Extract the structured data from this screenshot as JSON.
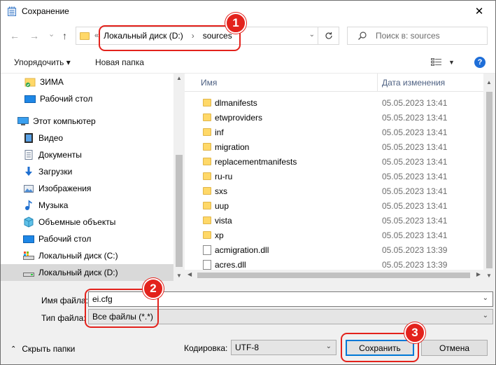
{
  "window": {
    "title": "Сохранение",
    "close_glyph": "✕"
  },
  "nav": {
    "back": "←",
    "forward": "→",
    "down": "⌄",
    "up": "↑"
  },
  "address": {
    "overflow": "«",
    "crumbs": [
      "Локальный диск (D:)",
      "sources"
    ],
    "separator": "›"
  },
  "search": {
    "placeholder": "Поиск в: sources"
  },
  "toolbar": {
    "organize": "Упорядочить ▾",
    "new_folder": "Новая папка",
    "help": "?"
  },
  "navpane": {
    "items": [
      {
        "label": "ЗИМА",
        "icon": "folder-shared-icon"
      },
      {
        "label": "Рабочий стол",
        "icon": "desktop-icon"
      },
      {
        "label": "Этот компьютер",
        "icon": "computer-icon"
      },
      {
        "label": "Видео",
        "icon": "video-icon"
      },
      {
        "label": "Документы",
        "icon": "documents-icon"
      },
      {
        "label": "Загрузки",
        "icon": "downloads-icon"
      },
      {
        "label": "Изображения",
        "icon": "pictures-icon"
      },
      {
        "label": "Музыка",
        "icon": "music-icon"
      },
      {
        "label": "Объемные объекты",
        "icon": "3d-objects-icon"
      },
      {
        "label": "Рабочий стол",
        "icon": "desktop-icon"
      },
      {
        "label": "Локальный диск (C:)",
        "icon": "drive-icon"
      },
      {
        "label": "Локальный диск (D:)",
        "icon": "drive-icon"
      }
    ]
  },
  "filelist": {
    "columns": {
      "name": "Имя",
      "date": "Дата изменения"
    },
    "rows": [
      {
        "name": "dlmanifests",
        "date": "05.05.2023 13:41",
        "type": "folder"
      },
      {
        "name": "etwproviders",
        "date": "05.05.2023 13:41",
        "type": "folder"
      },
      {
        "name": "inf",
        "date": "05.05.2023 13:41",
        "type": "folder"
      },
      {
        "name": "migration",
        "date": "05.05.2023 13:41",
        "type": "folder"
      },
      {
        "name": "replacementmanifests",
        "date": "05.05.2023 13:41",
        "type": "folder"
      },
      {
        "name": "ru-ru",
        "date": "05.05.2023 13:41",
        "type": "folder"
      },
      {
        "name": "sxs",
        "date": "05.05.2023 13:41",
        "type": "folder"
      },
      {
        "name": "uup",
        "date": "05.05.2023 13:41",
        "type": "folder"
      },
      {
        "name": "vista",
        "date": "05.05.2023 13:41",
        "type": "folder"
      },
      {
        "name": "xp",
        "date": "05.05.2023 13:41",
        "type": "folder"
      },
      {
        "name": "acmigration.dll",
        "date": "05.05.2023 13:39",
        "type": "dll"
      },
      {
        "name": "acres.dll",
        "date": "05.05.2023 13:39",
        "type": "dll"
      }
    ]
  },
  "form": {
    "filename_label": "Имя файла:",
    "filename_value": "ei.cfg",
    "filetype_label": "Тип файла:",
    "filetype_value": "Все файлы  (*.*)",
    "hide_folders": "Скрыть папки",
    "encoding_label": "Кодировка:",
    "encoding_value": "UTF-8",
    "save": "Сохранить",
    "cancel": "Отмена"
  },
  "annotations": {
    "badge1": "1",
    "badge2": "2",
    "badge3": "3",
    "color": "#e3221c"
  }
}
